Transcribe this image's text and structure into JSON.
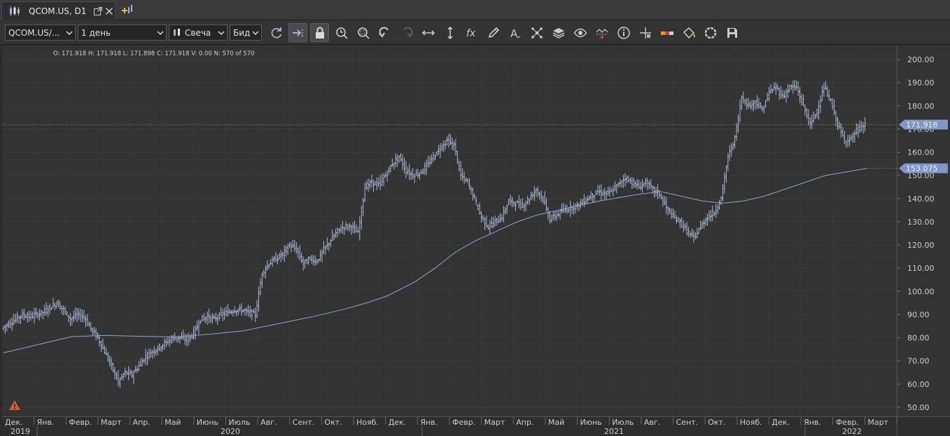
{
  "tab": {
    "title": "QCOM.US, D1"
  },
  "toolbar": {
    "symbol": "QCOM.US/...",
    "timeframe": "1 день",
    "chart_type": "Свеча",
    "price_side": "Бид"
  },
  "ohlc_readout": "O: 171.918  H: 171.918  L: 171.898  C: 171.918  V: 0.00  N: 570 of 570",
  "price_labels": {
    "last": "171.918",
    "ma": "153.075"
  },
  "colors": {
    "background": "#333333",
    "bars": "#a9b9d6",
    "ma_line": "#8ea6d8",
    "label_bg": "#7d97c6",
    "grid": "#3d3d3d"
  },
  "chart_data": {
    "type": "ohlc",
    "ylim": [
      45,
      205
    ],
    "y_ticks": [
      50,
      60,
      70,
      80,
      90,
      100,
      110,
      120,
      130,
      140,
      150,
      160,
      170,
      180,
      190,
      200
    ],
    "y_tick_labels": [
      "50.00",
      "60.00",
      "70.00",
      "80.00",
      "90.00",
      "100.00",
      "110.00",
      "120.00",
      "130.00",
      "140.00",
      "150.00",
      "160.00",
      "170.00",
      "180.00",
      "190.00",
      "200.00"
    ],
    "months": [
      "Дек.",
      "Янв.",
      "Февр.",
      "Март",
      "Апр.",
      "Май",
      "Июнь",
      "Июль",
      "Авг.",
      "Сент.",
      "Окт.",
      "Нояб.",
      "Дек.",
      "Янв.",
      "Февр.",
      "Март",
      "Апр.",
      "Май",
      "Июнь",
      "Июль",
      "Авг.",
      "Сент.",
      "Окт.",
      "Нояб.",
      "Дек.",
      "Янв.",
      "Февр.",
      "Март"
    ],
    "years": [
      "2019",
      "2020",
      "2021",
      "2022"
    ],
    "price_series": [
      [
        0,
        84
      ],
      [
        1,
        86
      ],
      [
        2,
        88
      ],
      [
        3,
        90
      ],
      [
        4,
        89
      ],
      [
        5,
        90
      ],
      [
        6,
        91
      ],
      [
        7,
        93
      ],
      [
        8,
        95
      ],
      [
        9,
        92
      ],
      [
        10,
        88
      ],
      [
        11,
        90
      ],
      [
        12,
        89
      ],
      [
        13,
        84
      ],
      [
        14,
        80
      ],
      [
        15,
        74
      ],
      [
        16,
        68
      ],
      [
        17,
        61
      ],
      [
        18,
        65
      ],
      [
        19,
        64
      ],
      [
        20,
        68
      ],
      [
        21,
        72
      ],
      [
        22,
        74
      ],
      [
        23,
        76
      ],
      [
        24,
        78
      ],
      [
        25,
        80
      ],
      [
        26,
        80
      ],
      [
        27,
        79
      ],
      [
        28,
        82
      ],
      [
        29,
        88
      ],
      [
        30,
        89
      ],
      [
        31,
        88
      ],
      [
        32,
        90
      ],
      [
        33,
        91
      ],
      [
        34,
        92
      ],
      [
        35,
        92
      ],
      [
        36,
        91
      ],
      [
        37,
        90
      ],
      [
        38,
        108
      ],
      [
        39,
        112
      ],
      [
        40,
        114
      ],
      [
        41,
        116
      ],
      [
        42,
        120
      ],
      [
        43,
        118
      ],
      [
        44,
        112
      ],
      [
        45,
        114
      ],
      [
        46,
        113
      ],
      [
        47,
        118
      ],
      [
        48,
        122
      ],
      [
        49,
        126
      ],
      [
        50,
        128
      ],
      [
        51,
        128
      ],
      [
        52,
        125
      ],
      [
        53,
        145
      ],
      [
        54,
        147
      ],
      [
        55,
        146
      ],
      [
        56,
        150
      ],
      [
        57,
        155
      ],
      [
        58,
        158
      ],
      [
        59,
        152
      ],
      [
        60,
        150
      ],
      [
        61,
        151
      ],
      [
        62,
        154
      ],
      [
        63,
        158
      ],
      [
        64,
        162
      ],
      [
        65,
        165
      ],
      [
        66,
        163
      ],
      [
        67,
        150
      ],
      [
        68,
        147
      ],
      [
        69,
        140
      ],
      [
        70,
        132
      ],
      [
        71,
        128
      ],
      [
        72,
        130
      ],
      [
        73,
        132
      ],
      [
        74,
        139
      ],
      [
        75,
        138
      ],
      [
        76,
        137
      ],
      [
        77,
        140
      ],
      [
        78,
        144
      ],
      [
        79,
        140
      ],
      [
        80,
        131
      ],
      [
        81,
        133
      ],
      [
        82,
        135
      ],
      [
        83,
        136
      ],
      [
        84,
        137
      ],
      [
        85,
        139
      ],
      [
        86,
        141
      ],
      [
        87,
        143
      ],
      [
        88,
        142
      ],
      [
        89,
        143
      ],
      [
        90,
        146
      ],
      [
        91,
        149
      ],
      [
        92,
        147
      ],
      [
        93,
        145
      ],
      [
        94,
        147
      ],
      [
        95,
        144
      ],
      [
        96,
        142
      ],
      [
        97,
        136
      ],
      [
        98,
        132
      ],
      [
        99,
        130
      ],
      [
        100,
        126
      ],
      [
        101,
        123
      ],
      [
        102,
        128
      ],
      [
        103,
        132
      ],
      [
        104,
        134
      ],
      [
        105,
        140
      ],
      [
        106,
        158
      ],
      [
        107,
        166
      ],
      [
        108,
        184
      ],
      [
        109,
        180
      ],
      [
        110,
        182
      ],
      [
        111,
        178
      ],
      [
        112,
        186
      ],
      [
        113,
        188
      ],
      [
        114,
        184
      ],
      [
        115,
        188
      ],
      [
        116,
        188
      ],
      [
        117,
        180
      ],
      [
        118,
        172
      ],
      [
        119,
        178
      ],
      [
        120,
        188
      ],
      [
        121,
        182
      ],
      [
        122,
        172
      ],
      [
        123,
        165
      ],
      [
        124,
        166
      ],
      [
        125,
        170
      ],
      [
        126,
        172
      ]
    ],
    "moving_average": [
      [
        0,
        73.5
      ],
      [
        5,
        77
      ],
      [
        10,
        80.5
      ],
      [
        15,
        81
      ],
      [
        20,
        80.6
      ],
      [
        25,
        80.4
      ],
      [
        30,
        81.5
      ],
      [
        35,
        83
      ],
      [
        40,
        86
      ],
      [
        45,
        89
      ],
      [
        50,
        92.5
      ],
      [
        53,
        95
      ],
      [
        56,
        98
      ],
      [
        60,
        104
      ],
      [
        63,
        110
      ],
      [
        66,
        117
      ],
      [
        69,
        122
      ],
      [
        72,
        126
      ],
      [
        75,
        130
      ],
      [
        78,
        133
      ],
      [
        81,
        135
      ],
      [
        84,
        137
      ],
      [
        87,
        139
      ],
      [
        90,
        140.5
      ],
      [
        93,
        142
      ],
      [
        96,
        143
      ],
      [
        99,
        141
      ],
      [
        102,
        139
      ],
      [
        105,
        138
      ],
      [
        108,
        139
      ],
      [
        111,
        141
      ],
      [
        114,
        144
      ],
      [
        117,
        147
      ],
      [
        120,
        150
      ],
      [
        123,
        151.5
      ],
      [
        126,
        153.075
      ]
    ],
    "last_price": 171.918,
    "ma_last": 153.075
  }
}
